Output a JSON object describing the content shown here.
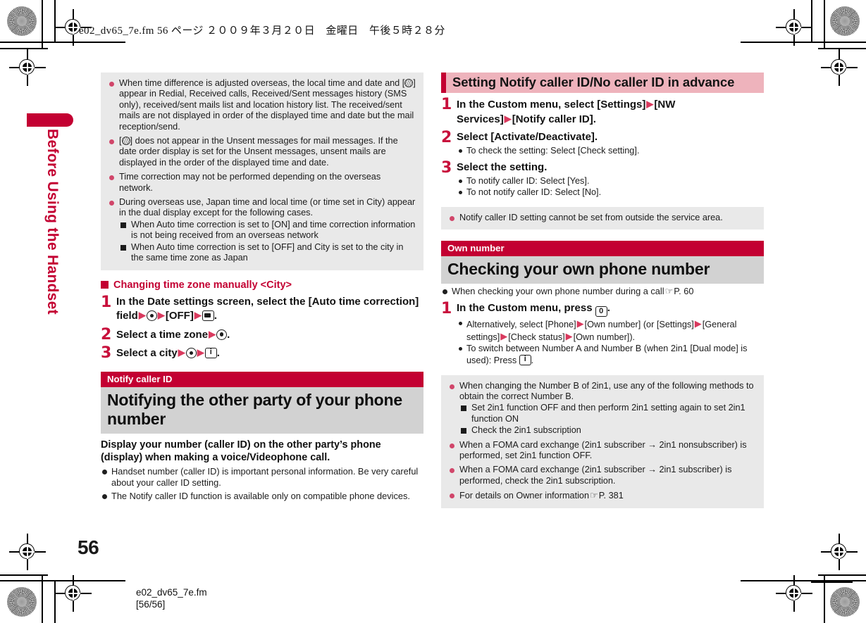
{
  "header": {
    "slug": "e02_dv65_7e.fm  56 ページ  ２００９年３月２０日　金曜日　午後５時２８分"
  },
  "sidebar": {
    "chapter_label": "Before Using the Handset",
    "accent_color": "#c30032"
  },
  "footer": {
    "page_number": "56",
    "file_slug": "e02_dv65_7e.fm",
    "page_of": "[56/56]"
  },
  "left_column": {
    "notes_top": [
      {
        "text_a": "When time difference is adjusted overseas, the local time and date and [",
        "icon": "mail-clock-icon",
        "text_b": "] appear in Redial, Received calls, Received/Sent messages history (SMS only), received/sent mails list and location history list. The received/sent mails are not displayed in order of the displayed time and date but the mail reception/send."
      },
      {
        "text_a": "[",
        "icon": "mail-clock-icon",
        "text_b": "] does not appear in the Unsent messages for mail messages. If the date order display is set for the Unsent messages, unsent mails are displayed in the order of the displayed time and date."
      },
      {
        "text_a": "Time correction may not be performed depending on the overseas network.",
        "icon": "",
        "text_b": ""
      },
      {
        "text_a": "During overseas use, Japan time and local time (or time set in City) appear in the dual display except for the following cases.",
        "icon": "",
        "text_b": "",
        "sub": [
          "When Auto time correction is set to [ON] and time correction information is not being received from an overseas network",
          "When Auto time correction is set to [OFF] and City is set to the city in the same time zone as Japan"
        ]
      }
    ],
    "subheading": "Changing time zone manually <City>",
    "steps": [
      {
        "num": "1",
        "parts": [
          {
            "t": "text",
            "v": "In the Date settings screen, select the [Auto time correction] field"
          },
          {
            "t": "arrow",
            "v": "▶"
          },
          {
            "t": "key-center",
            "v": ""
          },
          {
            "t": "arrow",
            "v": "▶"
          },
          {
            "t": "text",
            "v": "[OFF]"
          },
          {
            "t": "arrow",
            "v": "▶"
          },
          {
            "t": "key-camera",
            "v": ""
          },
          {
            "t": "text",
            "v": "."
          }
        ]
      },
      {
        "num": "2",
        "parts": [
          {
            "t": "text",
            "v": "Select a time zone"
          },
          {
            "t": "arrow",
            "v": "▶"
          },
          {
            "t": "key-center",
            "v": ""
          },
          {
            "t": "text",
            "v": "."
          }
        ]
      },
      {
        "num": "3",
        "parts": [
          {
            "t": "text",
            "v": "Select a city"
          },
          {
            "t": "arrow",
            "v": "▶"
          },
          {
            "t": "key-center",
            "v": ""
          },
          {
            "t": "arrow",
            "v": "▶"
          },
          {
            "t": "key-info",
            "v": ""
          },
          {
            "t": "text",
            "v": "."
          }
        ]
      }
    ],
    "section": {
      "kicker": "Notify caller ID",
      "title": "Notifying the other party of your phone number",
      "lead": "Display your number (caller ID) on the other party’s phone (display) when making a voice/Videophone call.",
      "bullets": [
        "Handset number (caller ID) is important personal information. Be very careful about your caller ID setting.",
        "The Notify caller ID function is available only on compatible phone devices."
      ]
    }
  },
  "right_column": {
    "pink_heading": "Setting Notify caller ID/No caller ID in advance",
    "steps": [
      {
        "num": "1",
        "parts": [
          {
            "t": "text",
            "v": "In the Custom menu, select [Settings]"
          },
          {
            "t": "arrow",
            "v": "▶"
          },
          {
            "t": "text",
            "v": "[NW Services]"
          },
          {
            "t": "arrow",
            "v": "▶"
          },
          {
            "t": "text",
            "v": "[Notify caller ID]."
          }
        ],
        "sub": []
      },
      {
        "num": "2",
        "parts": [
          {
            "t": "text",
            "v": "Select [Activate/Deactivate]."
          }
        ],
        "sub": [
          "To check the setting: Select [Check setting]."
        ]
      },
      {
        "num": "3",
        "parts": [
          {
            "t": "text",
            "v": "Select the setting."
          }
        ],
        "sub": [
          "To notify caller ID: Select [Yes].",
          "To not notify caller ID: Select [No]."
        ]
      }
    ],
    "note_single": "Notify caller ID setting cannot be set from outside the service area.",
    "section": {
      "kicker": "Own number",
      "title": "Checking your own phone number",
      "pre_bullet_text": "When checking your own phone number during a call",
      "pre_bullet_ref": "P. 60"
    },
    "step_own": {
      "num": "1",
      "text_before": "In the Custom menu, press",
      "key_label": "0",
      "text_after": ".",
      "sub": [
        [
          {
            "t": "text",
            "v": "Alternatively, select [Phone]"
          },
          {
            "t": "arrow",
            "v": "▶"
          },
          {
            "t": "text",
            "v": "[Own number] (or [Settings]"
          },
          {
            "t": "arrow",
            "v": "▶"
          },
          {
            "t": "text",
            "v": "[General settings]"
          },
          {
            "t": "arrow",
            "v": "▶"
          },
          {
            "t": "text",
            "v": "[Check status]"
          },
          {
            "t": "arrow",
            "v": "▶"
          },
          {
            "t": "text",
            "v": "[Own number])."
          }
        ],
        [
          {
            "t": "text",
            "v": "To switch between Number A and Number B (when 2in1 [Dual mode] is used): Press"
          },
          {
            "t": "key-info",
            "v": ""
          },
          {
            "t": "text",
            "v": "."
          }
        ]
      ]
    },
    "notes_bottom": [
      {
        "text": "When changing the Number B of 2in1, use any of the following methods to obtain the correct Number B.",
        "sub": [
          "Set 2in1 function OFF and then perform 2in1 setting again to set 2in1 function ON",
          "Check the 2in1 subscription"
        ]
      },
      {
        "text": "When a FOMA card exchange (2in1 subscriber → 2in1 nonsubscriber) is performed, set 2in1 function OFF.",
        "sub": []
      },
      {
        "text": "When a FOMA card exchange (2in1 subscriber → 2in1 subscriber) is performed, check the 2in1 subscription.",
        "sub": []
      },
      {
        "text_ref_prefix": "For details on Owner information",
        "text_ref": "P. 381",
        "sub": []
      }
    ]
  }
}
